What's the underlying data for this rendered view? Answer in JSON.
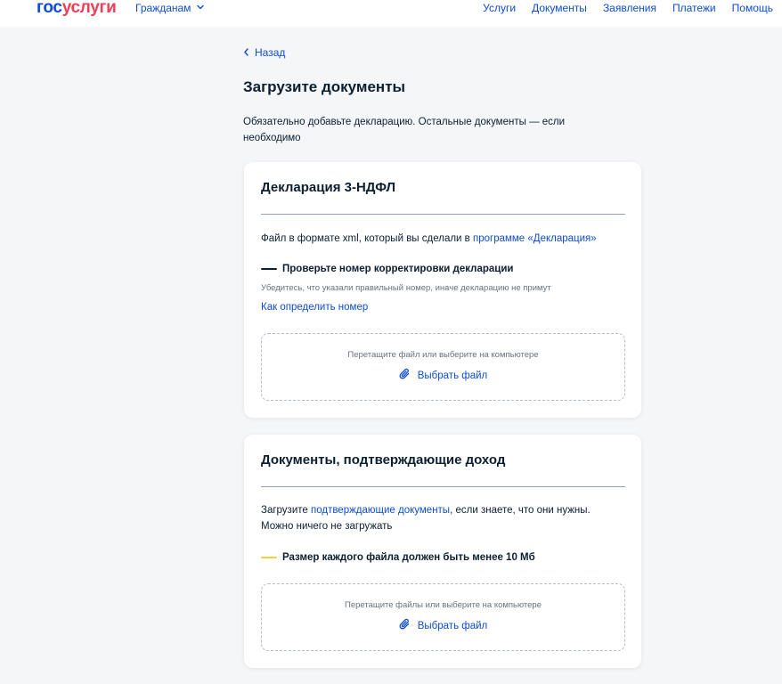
{
  "header": {
    "logo_part1": "гос",
    "logo_part2": "услуги",
    "citizens": "Гражданам",
    "nav": [
      "Услуги",
      "Документы",
      "Заявления",
      "Платежи",
      "Помощь"
    ]
  },
  "back": "Назад",
  "page_title": "Загрузите документы",
  "intro": "Обязательно добавьте декларацию. Остальные документы — если необходимо",
  "declaration_card": {
    "title": "Декларация 3-НДФЛ",
    "text_before": "Файл в формате xml, который вы сделали в ",
    "text_link": "программе «Декларация»",
    "notice_title": "Проверьте номер корректировки декларации",
    "notice_sub": "Убедитесь, что указали правильный номер, иначе декларацию не примут",
    "help_link": "Как определить номер",
    "dropzone_hint": "Перетащите файл или выберите на компьютере",
    "dropzone_button": "Выбрать файл"
  },
  "income_card": {
    "title": "Документы, подтверждающие доход",
    "text_before": "Загрузите ",
    "text_link": "подтверждающие документы",
    "text_after": ", если знаете, что они нужны.",
    "text_line2": "Можно ничего не загружать",
    "notice_title": "Размер каждого файла должен быть менее 10 Мб",
    "dropzone_hint": "Перетащите файлы или выберите на компьютере",
    "dropzone_button": "Выбрать файл"
  },
  "colors": {
    "accent": "#0d4cd3",
    "logo_red": "#ee3f58",
    "notice_dark": "#0b1f33",
    "notice_yellow": "#f6d02f"
  }
}
